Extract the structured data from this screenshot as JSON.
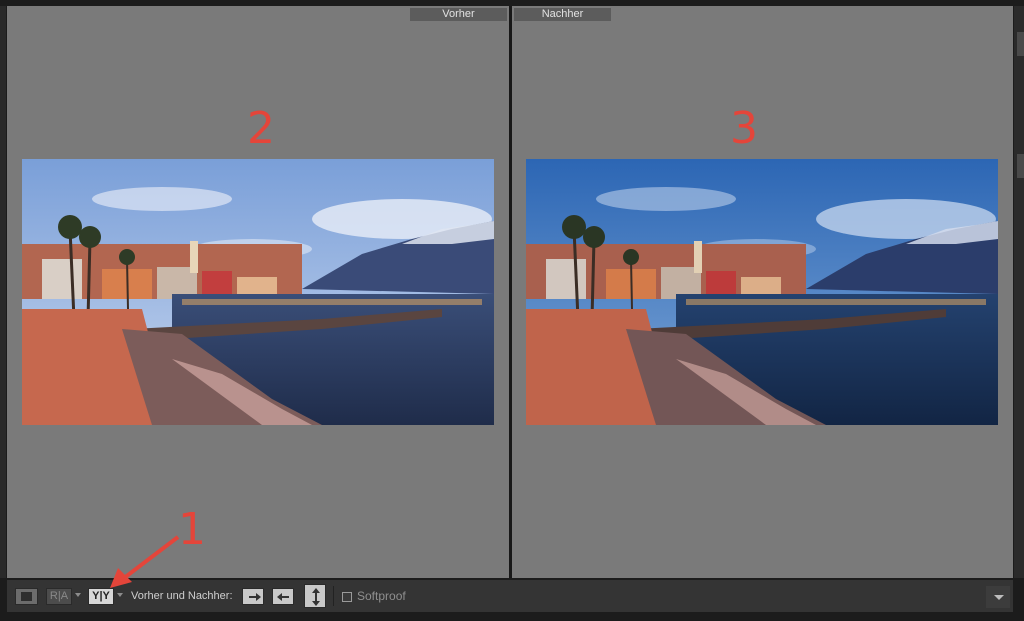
{
  "panels": {
    "before": {
      "label": "Vorher",
      "marker": "2"
    },
    "after": {
      "label": "Nachher",
      "marker": "3"
    }
  },
  "toolbar": {
    "loupe_icon": "single-view-icon",
    "ra_label": "R|A",
    "yy_label": "Y|Y",
    "before_after_label": "Vorher und Nachher:",
    "copy_before_to_after_icon": "arrow-right-icon",
    "copy_after_to_before_icon": "arrow-left-icon",
    "swap_icon": "swap-vertical-icon",
    "softproof_label": "Softproof",
    "softproof_checked": false
  },
  "annotations": {
    "arrow_marker": "1"
  },
  "colors": {
    "marker": "#e4453a",
    "panel_bg": "#7a7a7a",
    "toolbar_bg": "#343434"
  }
}
